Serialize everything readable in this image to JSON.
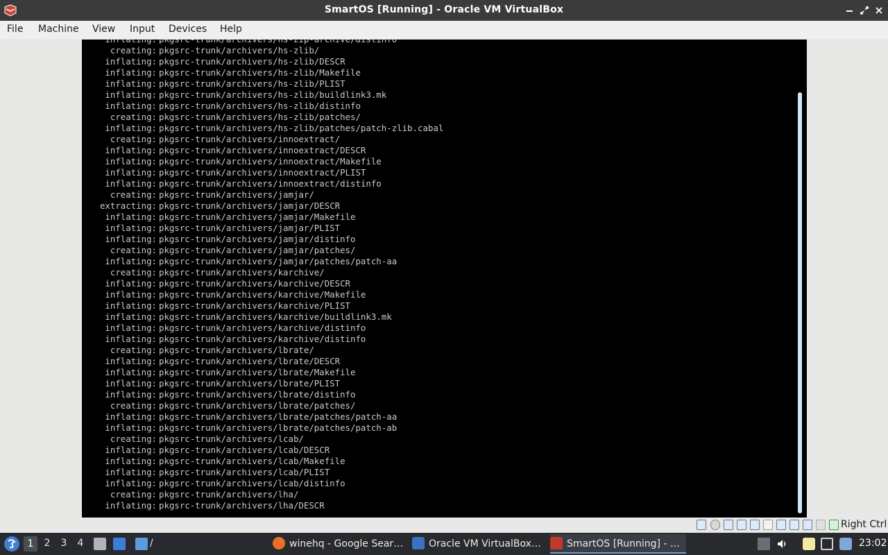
{
  "window": {
    "title": "SmartOS [Running] - Oracle VM VirtualBox",
    "minimize_icon": "minimize-icon",
    "restore_icon": "restore-icon",
    "close_icon": "close-icon"
  },
  "menu": {
    "items": [
      "File",
      "Machine",
      "View",
      "Input",
      "Devices",
      "Help"
    ]
  },
  "console": {
    "lines": [
      {
        "verb": "inflating:",
        "path": "pkgsrc-trunk/archivers/hs-zip-archive/distinfo"
      },
      {
        "verb": "creating:",
        "path": "pkgsrc-trunk/archivers/hs-zlib/"
      },
      {
        "verb": "inflating:",
        "path": "pkgsrc-trunk/archivers/hs-zlib/DESCR"
      },
      {
        "verb": "inflating:",
        "path": "pkgsrc-trunk/archivers/hs-zlib/Makefile"
      },
      {
        "verb": "inflating:",
        "path": "pkgsrc-trunk/archivers/hs-zlib/PLIST"
      },
      {
        "verb": "inflating:",
        "path": "pkgsrc-trunk/archivers/hs-zlib/buildlink3.mk"
      },
      {
        "verb": "inflating:",
        "path": "pkgsrc-trunk/archivers/hs-zlib/distinfo"
      },
      {
        "verb": "creating:",
        "path": "pkgsrc-trunk/archivers/hs-zlib/patches/"
      },
      {
        "verb": "inflating:",
        "path": "pkgsrc-trunk/archivers/hs-zlib/patches/patch-zlib.cabal"
      },
      {
        "verb": "creating:",
        "path": "pkgsrc-trunk/archivers/innoextract/"
      },
      {
        "verb": "inflating:",
        "path": "pkgsrc-trunk/archivers/innoextract/DESCR"
      },
      {
        "verb": "inflating:",
        "path": "pkgsrc-trunk/archivers/innoextract/Makefile"
      },
      {
        "verb": "inflating:",
        "path": "pkgsrc-trunk/archivers/innoextract/PLIST"
      },
      {
        "verb": "inflating:",
        "path": "pkgsrc-trunk/archivers/innoextract/distinfo"
      },
      {
        "verb": "creating:",
        "path": "pkgsrc-trunk/archivers/jamjar/"
      },
      {
        "verb": "extracting:",
        "path": "pkgsrc-trunk/archivers/jamjar/DESCR"
      },
      {
        "verb": "inflating:",
        "path": "pkgsrc-trunk/archivers/jamjar/Makefile"
      },
      {
        "verb": "inflating:",
        "path": "pkgsrc-trunk/archivers/jamjar/PLIST"
      },
      {
        "verb": "inflating:",
        "path": "pkgsrc-trunk/archivers/jamjar/distinfo"
      },
      {
        "verb": "creating:",
        "path": "pkgsrc-trunk/archivers/jamjar/patches/"
      },
      {
        "verb": "inflating:",
        "path": "pkgsrc-trunk/archivers/jamjar/patches/patch-aa"
      },
      {
        "verb": "creating:",
        "path": "pkgsrc-trunk/archivers/karchive/"
      },
      {
        "verb": "inflating:",
        "path": "pkgsrc-trunk/archivers/karchive/DESCR"
      },
      {
        "verb": "inflating:",
        "path": "pkgsrc-trunk/archivers/karchive/Makefile"
      },
      {
        "verb": "inflating:",
        "path": "pkgsrc-trunk/archivers/karchive/PLIST"
      },
      {
        "verb": "inflating:",
        "path": "pkgsrc-trunk/archivers/karchive/buildlink3.mk"
      },
      {
        "verb": "inflating:",
        "path": "pkgsrc-trunk/archivers/karchive/distinfo"
      },
      {
        "verb": "inflating:",
        "path": "pkgsrc-trunk/archivers/karchive/distinfo"
      },
      {
        "verb": "creating:",
        "path": "pkgsrc-trunk/archivers/lbrate/"
      },
      {
        "verb": "inflating:",
        "path": "pkgsrc-trunk/archivers/lbrate/DESCR"
      },
      {
        "verb": "inflating:",
        "path": "pkgsrc-trunk/archivers/lbrate/Makefile"
      },
      {
        "verb": "inflating:",
        "path": "pkgsrc-trunk/archivers/lbrate/PLIST"
      },
      {
        "verb": "inflating:",
        "path": "pkgsrc-trunk/archivers/lbrate/distinfo"
      },
      {
        "verb": "creating:",
        "path": "pkgsrc-trunk/archivers/lbrate/patches/"
      },
      {
        "verb": "inflating:",
        "path": "pkgsrc-trunk/archivers/lbrate/patches/patch-aa"
      },
      {
        "verb": "inflating:",
        "path": "pkgsrc-trunk/archivers/lbrate/patches/patch-ab"
      },
      {
        "verb": "creating:",
        "path": "pkgsrc-trunk/archivers/lcab/"
      },
      {
        "verb": "inflating:",
        "path": "pkgsrc-trunk/archivers/lcab/DESCR"
      },
      {
        "verb": "inflating:",
        "path": "pkgsrc-trunk/archivers/lcab/Makefile"
      },
      {
        "verb": "inflating:",
        "path": "pkgsrc-trunk/archivers/lcab/PLIST"
      },
      {
        "verb": "inflating:",
        "path": "pkgsrc-trunk/archivers/lcab/distinfo"
      },
      {
        "verb": "creating:",
        "path": "pkgsrc-trunk/archivers/lha/"
      },
      {
        "verb": "inflating:",
        "path": "pkgsrc-trunk/archivers/lha/DESCR"
      }
    ]
  },
  "statusbar": {
    "icons": [
      "hard-disk-icon",
      "optical-drive-icon",
      "audio-icon",
      "network-icon",
      "usb-icon",
      "shared-folder-icon",
      "display-icon",
      "video-capture-icon",
      "cpu-icon",
      "mouse-integration-icon",
      "keyboard-icon"
    ],
    "host_key": "Right Ctrl"
  },
  "taskbar": {
    "workspaces": [
      "1",
      "2",
      "3",
      "4"
    ],
    "path_label": "/",
    "tasks": [
      {
        "label": "winehq - Google Sear…",
        "icon": "firefox-icon",
        "color": "#e8702a"
      },
      {
        "label": "Oracle VM VirtualBox…",
        "icon": "virtualbox-icon",
        "color": "#3a73c2"
      },
      {
        "label": "SmartOS [Running] - …",
        "icon": "virtualbox-vm-icon",
        "color": "#c0392b"
      }
    ],
    "clock": "23:02"
  },
  "colors": {
    "titlebar": "#3b3b3b",
    "console_bg": "#000000",
    "console_text": "#c9c9c9",
    "taskbar": "#282a2e",
    "accent": "#6ea0d8"
  }
}
